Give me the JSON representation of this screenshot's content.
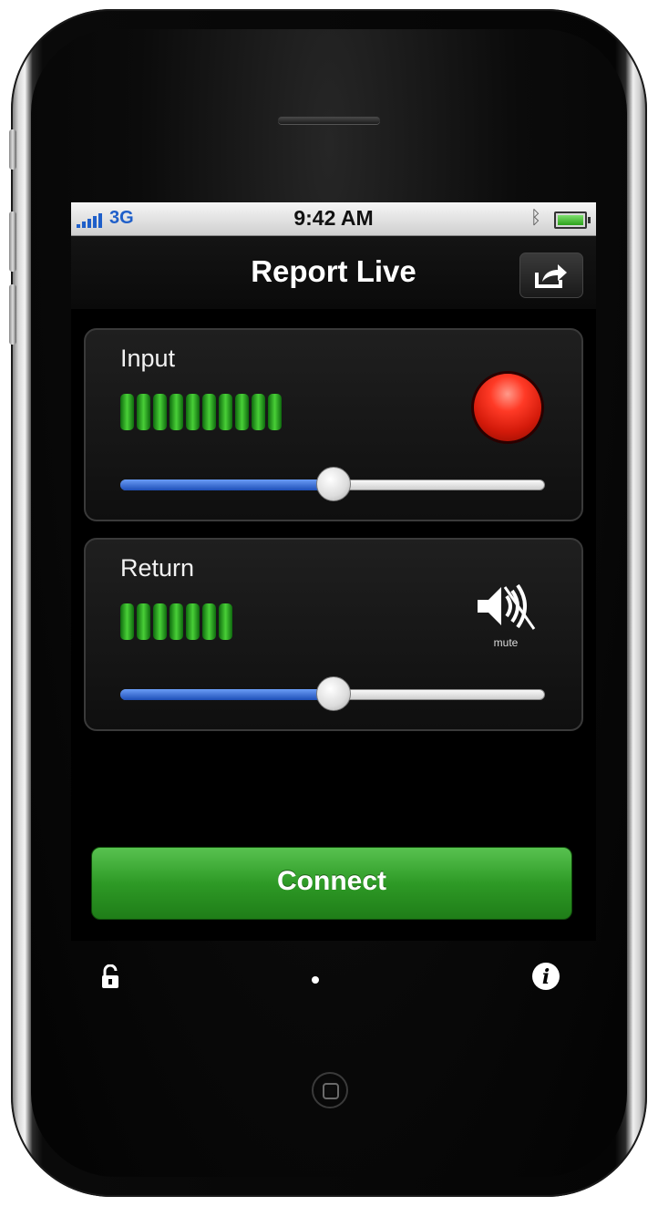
{
  "status_bar": {
    "network": "3G",
    "time": "9:42 AM",
    "bluetooth_icon": "bluetooth-icon",
    "battery_level": 1.0
  },
  "nav": {
    "title": "Report Live",
    "share_icon": "share-icon"
  },
  "input_panel": {
    "label": "Input",
    "meter_segments": 10,
    "slider_value": 0.5,
    "record_icon": "record-icon"
  },
  "return_panel": {
    "label": "Return",
    "meter_segments": 7,
    "slider_value": 0.5,
    "mute_label": "mute",
    "mute_icon": "speaker-mute-icon"
  },
  "connect_button": {
    "label": "Connect",
    "color": "#2e9a26"
  },
  "toolbar": {
    "lock_icon": "lock-icon",
    "page_indicator": "page-dot",
    "info_icon": "info-icon",
    "info_glyph": "i"
  },
  "colors": {
    "meter_green": "#49d037",
    "slider_blue": "#1e4fb8",
    "record_red": "#ff3a26"
  }
}
